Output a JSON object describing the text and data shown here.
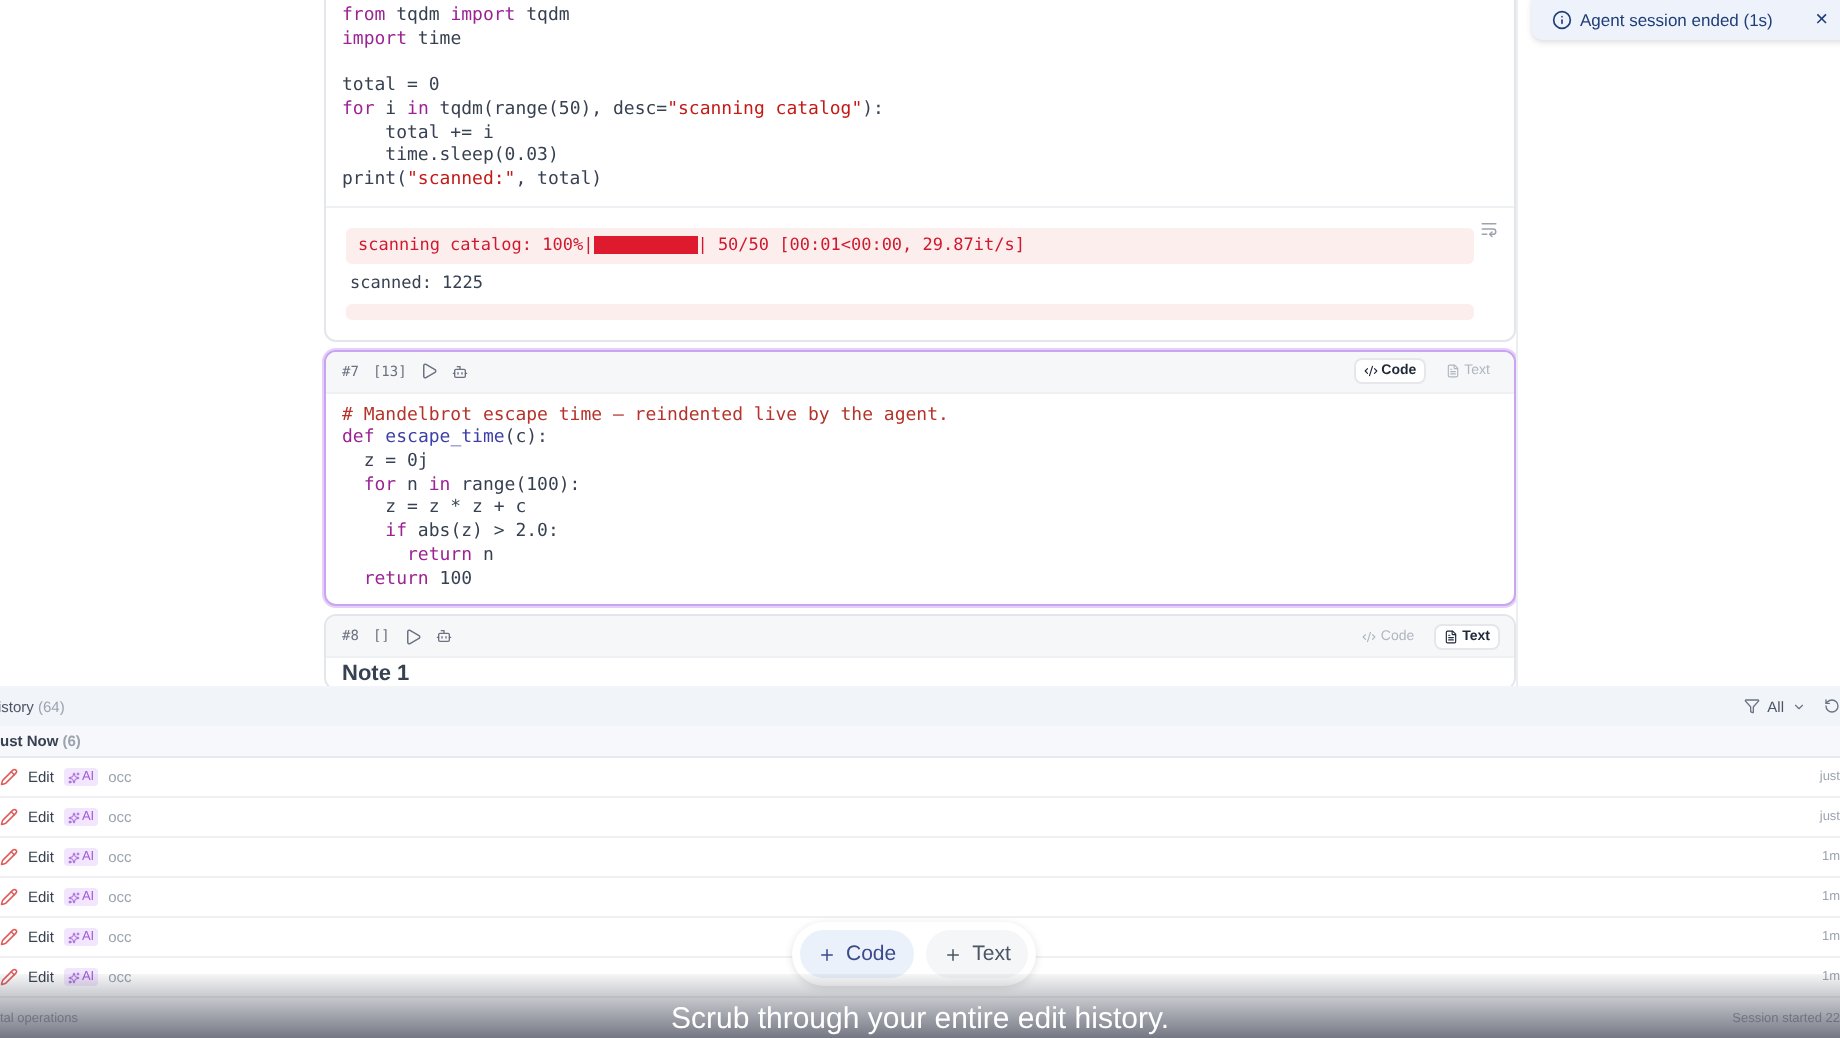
{
  "cells": [
    {
      "kind": "code",
      "code": [
        [
          {
            "kind": "kw",
            "t": "from"
          },
          {
            "kind": "p",
            "t": " tqdm "
          },
          {
            "kind": "kw",
            "t": "import"
          },
          {
            "kind": "p",
            "t": " tqdm"
          }
        ],
        [
          {
            "kind": "kw",
            "t": "import"
          },
          {
            "kind": "p",
            "t": " time"
          }
        ],
        [
          {
            "kind": "gap",
            "t": "total = 0"
          }
        ],
        [
          {
            "kind": "kw",
            "t": "for"
          },
          {
            "kind": "p",
            "t": " i "
          },
          {
            "kind": "kw",
            "t": "in"
          },
          {
            "kind": "p",
            "t": " tqdm(range(50), desc="
          },
          {
            "kind": "str",
            "t": "\"scanning catalog\""
          },
          {
            "kind": "p",
            "t": "):"
          }
        ],
        [
          {
            "kind": "p",
            "t": "    total += i"
          }
        ],
        [
          {
            "kind": "p",
            "t": "    time.sleep(0.03)"
          }
        ],
        [
          {
            "kind": "p",
            "t": "print("
          },
          {
            "kind": "str",
            "t": "\"scanned:\""
          },
          {
            "kind": "p",
            "t": ", total)"
          }
        ]
      ],
      "output": {
        "progress_label": "scanning catalog: 100%|",
        "level": 1,
        "progress_tail": "| 50/50 [00:01<00:00, 29.87it/s]",
        "stdout": "scanned: 1225"
      }
    },
    {
      "kind": "code",
      "index": "#7",
      "count": "[13]",
      "focused": true,
      "modes": [
        {
          "label": "Code",
          "selected": true
        },
        {
          "label": "Text",
          "selected": false
        }
      ],
      "code": [
        [
          {
            "kind": "cm",
            "t": "# Mandelbrot escape time — reindented live by the agent."
          }
        ],
        [
          {
            "kind": "kw",
            "t": "def"
          },
          {
            "kind": "fn",
            "t": " escape_time"
          },
          {
            "kind": "p",
            "t": "(c):"
          }
        ],
        [
          {
            "kind": "p",
            "t": "  z = 0j"
          }
        ],
        [
          {
            "kind": "kw",
            "t": "  for"
          },
          {
            "kind": "p",
            "t": " n "
          },
          {
            "kind": "kw",
            "t": "in"
          },
          {
            "kind": "p",
            "t": " range(100):"
          }
        ],
        [
          {
            "kind": "p",
            "t": "    z = z * z + c"
          }
        ],
        [
          {
            "kind": "kw",
            "t": "    if"
          },
          {
            "kind": "p",
            "t": " abs(z) > 2.0:"
          }
        ],
        [
          {
            "kind": "kw",
            "t": "      return"
          },
          {
            "kind": "p",
            "t": " n"
          }
        ],
        [
          {
            "kind": "kw",
            "t": "  return"
          },
          {
            "kind": "p",
            "t": " 100"
          }
        ]
      ]
    },
    {
      "kind": "text",
      "index": "#8",
      "count": "[]",
      "focused": false,
      "modes": [
        {
          "label": "Code",
          "selected": false
        },
        {
          "label": "Text",
          "selected": true
        }
      ],
      "heading": "Note 1"
    }
  ],
  "toast": {
    "text": "Agent session ended (1s)",
    "close": "×"
  },
  "history": {
    "title": "istory",
    "count": "(64)",
    "filter": "All",
    "group": {
      "title": "ust Now",
      "count": "(6)"
    },
    "rows": [
      {
        "action": "Edit",
        "badge": "AI",
        "detail": "occ",
        "time": "just"
      },
      {
        "action": "Edit",
        "badge": "AI",
        "detail": "occ",
        "time": "just"
      },
      {
        "action": "Edit",
        "badge": "AI",
        "detail": "occ",
        "time": "1m"
      },
      {
        "action": "Edit",
        "badge": "AI",
        "detail": "occ",
        "time": "1m"
      },
      {
        "action": "Edit",
        "badge": "AI",
        "detail": "occ",
        "time": "1m"
      },
      {
        "action": "Edit",
        "badge": "AI",
        "detail": "occ",
        "time": "1m"
      }
    ],
    "footer_left": "tal operations",
    "footer_right": "Session started 22"
  },
  "add_bar": [
    {
      "label": "Code"
    },
    {
      "label": "Text"
    }
  ],
  "caption": "Scrub through your entire edit history."
}
